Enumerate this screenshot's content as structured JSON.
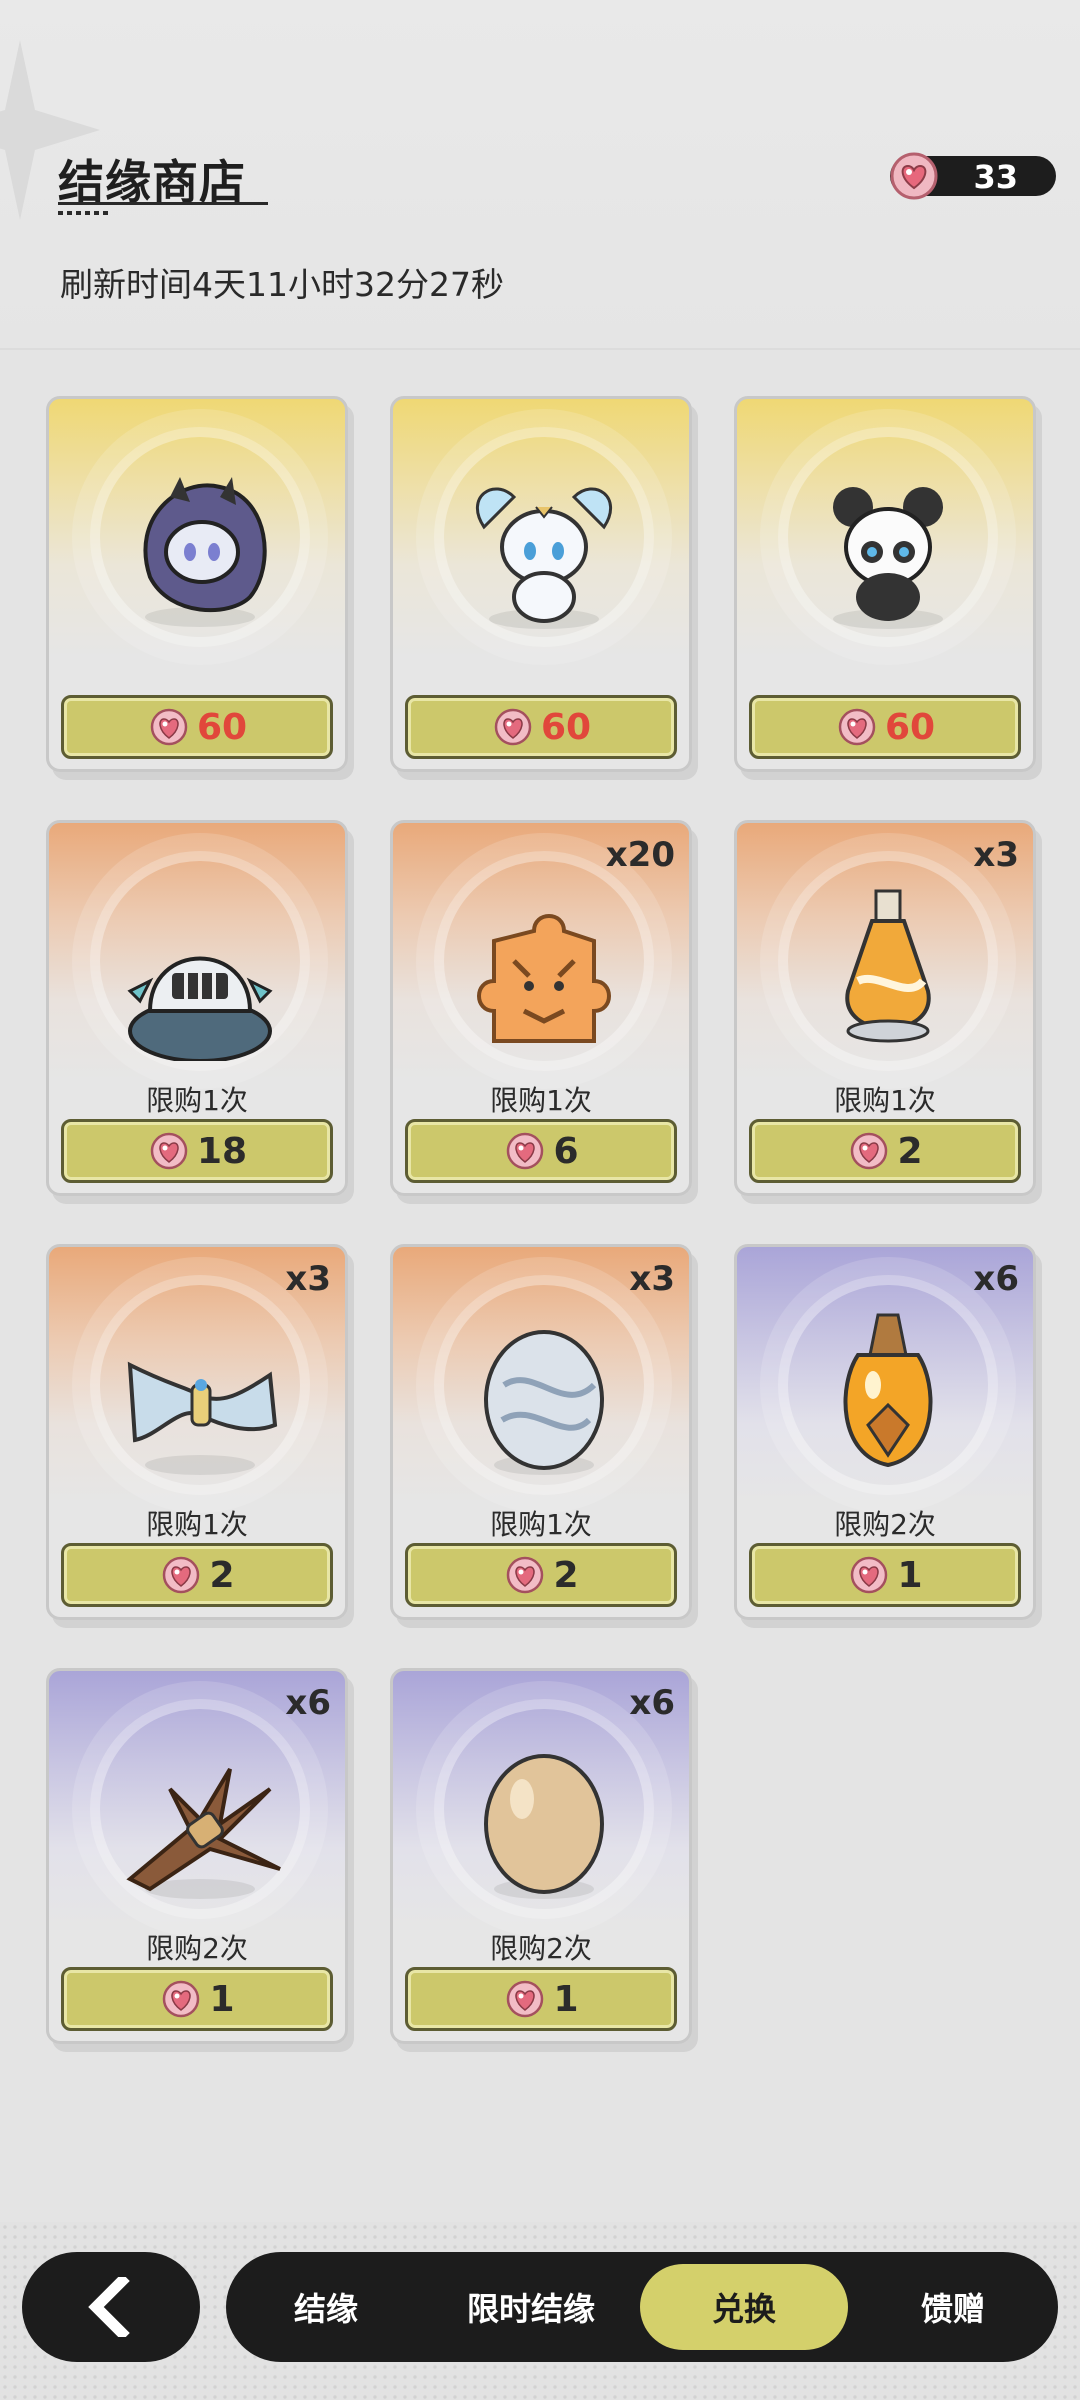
{
  "header": {
    "title": "结缘商店",
    "refresh_text": "刷新时间4天11小时32分27秒",
    "currency_amount": "33",
    "currency_icon": "pink-gem-heart-icon"
  },
  "colors": {
    "price_button": "#ccc86b",
    "price_red": "#e1473b",
    "tab_active": "#d4d06b",
    "dark": "#1c1c1c"
  },
  "items": [
    {
      "name": "purple-cloaked-pet",
      "rarity": "gold",
      "qty": "",
      "limit": "",
      "price": "60",
      "price_red": true
    },
    {
      "name": "ice-winged-fox-pet",
      "rarity": "gold",
      "qty": "",
      "limit": "",
      "price": "60",
      "price_red": true
    },
    {
      "name": "panda-ram-pet",
      "rarity": "gold",
      "qty": "",
      "limit": "",
      "price": "60",
      "price_red": true
    },
    {
      "name": "knight-helmet-slime",
      "rarity": "orange",
      "qty": "",
      "limit": "限购1次",
      "price": "18",
      "price_red": false
    },
    {
      "name": "tiger-puzzle-piece",
      "rarity": "orange",
      "qty": "x20",
      "limit": "限购1次",
      "price": "6",
      "price_red": false
    },
    {
      "name": "orange-potion-bottle",
      "rarity": "orange",
      "qty": "x3",
      "limit": "限购1次",
      "price": "2",
      "price_red": false
    },
    {
      "name": "silk-bundle",
      "rarity": "orange",
      "qty": "x3",
      "limit": "限购1次",
      "price": "2",
      "price_red": false
    },
    {
      "name": "silver-egg",
      "rarity": "orange",
      "qty": "x3",
      "limit": "限购1次",
      "price": "2",
      "price_red": false
    },
    {
      "name": "amber-vial",
      "rarity": "purple",
      "qty": "x6",
      "limit": "限购2次",
      "price": "1",
      "price_red": false
    },
    {
      "name": "straw-bundle",
      "rarity": "purple",
      "qty": "x6",
      "limit": "限购2次",
      "price": "1",
      "price_red": false
    },
    {
      "name": "brown-egg",
      "rarity": "purple",
      "qty": "x6",
      "limit": "限购2次",
      "price": "1",
      "price_red": false
    }
  ],
  "nav": {
    "back_icon": "chevron-left-icon",
    "tabs": [
      {
        "label": "结缘",
        "active": false
      },
      {
        "label": "限时结缘",
        "active": false
      },
      {
        "label": "兑换",
        "active": true
      },
      {
        "label": "馈赠",
        "active": false
      }
    ]
  }
}
